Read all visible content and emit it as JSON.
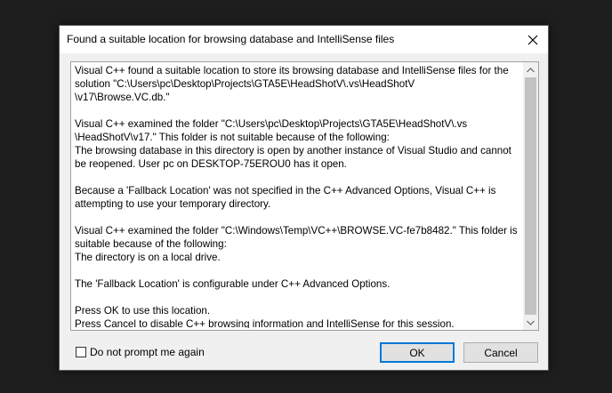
{
  "dialog": {
    "title": "Found a suitable location for browsing database and IntelliSense files",
    "paragraphs": [
      "Visual C++ found a suitable location to store its browsing database and IntelliSense files for the solution \"C:\\Users\\pc\\Desktop\\Projects\\GTA5E\\HeadShotV\\.vs\\HeadShotV\n\\v17\\Browse.VC.db.\"",
      "Visual C++ examined the folder \"C:\\Users\\pc\\Desktop\\Projects\\GTA5E\\HeadShotV\\.vs\n\\HeadShotV\\v17.\" This folder is not suitable because of the following:\nThe browsing database in this directory is open by another instance of Visual Studio and cannot be reopened.  User pc on DESKTOP-75EROU0 has it open.",
      "Because a 'Fallback Location' was not specified in the C++ Advanced Options, Visual C++ is attempting to use your temporary directory.",
      "Visual C++ examined the folder \"C:\\Windows\\Temp\\VC++\\BROWSE.VC-fe7b8482.\" This folder is suitable because of the following:\nThe directory is on a local drive.",
      "The 'Fallback Location' is configurable under C++ Advanced Options.",
      "Press OK to use this location.\nPress Cancel to disable C++ browsing information and IntelliSense for this session."
    ],
    "checkbox_label": "Do not prompt me again",
    "checkbox_checked": false,
    "ok_label": "OK",
    "cancel_label": "Cancel"
  },
  "colors": {
    "backdrop": "#1e1e1e",
    "dialog_bg": "#f0f0f0",
    "ok_border": "#0078d7"
  }
}
